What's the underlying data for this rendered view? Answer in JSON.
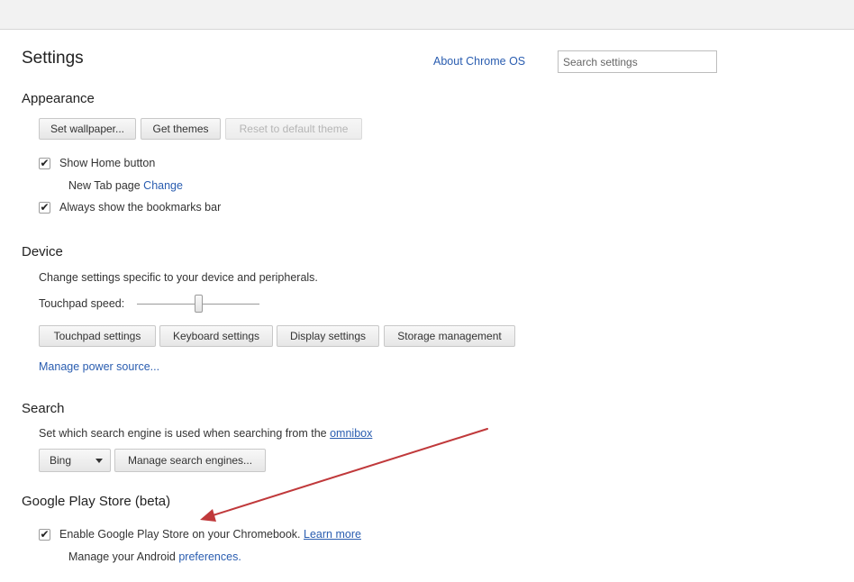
{
  "page": {
    "title": "Settings",
    "about_link": "About Chrome OS",
    "search_placeholder": "Search settings"
  },
  "appearance": {
    "heading": "Appearance",
    "set_wallpaper": "Set wallpaper...",
    "get_themes": "Get themes",
    "reset_theme": "Reset to default theme",
    "show_home_label": "Show Home button",
    "show_home_checked": true,
    "new_tab_text": "New Tab page",
    "change_link": "Change",
    "bookmarks_label": "Always show the bookmarks bar",
    "bookmarks_checked": true
  },
  "device": {
    "heading": "Device",
    "description": "Change settings specific to your device and peripherals.",
    "touchpad_speed_label": "Touchpad speed:",
    "touchpad_speed_level": 0.5,
    "touchpad_settings": "Touchpad settings",
    "keyboard_settings": "Keyboard settings",
    "display_settings": "Display settings",
    "storage_management": "Storage management",
    "manage_power": "Manage power source..."
  },
  "search": {
    "heading": "Search",
    "description_prefix": "Set which search engine is used when searching from the",
    "omnibox_link": "omnibox",
    "engine_selected": "Bing",
    "manage_engines": "Manage search engines..."
  },
  "play_store": {
    "heading": "Google Play Store (beta)",
    "enable_label": "Enable Google Play Store on your Chromebook.",
    "enable_checked": true,
    "learn_more": "Learn more",
    "manage_prefix": "Manage your Android",
    "preferences_link": "preferences."
  },
  "colors": {
    "link": "#2a5db0",
    "annotation_arrow": "#c0393b"
  }
}
